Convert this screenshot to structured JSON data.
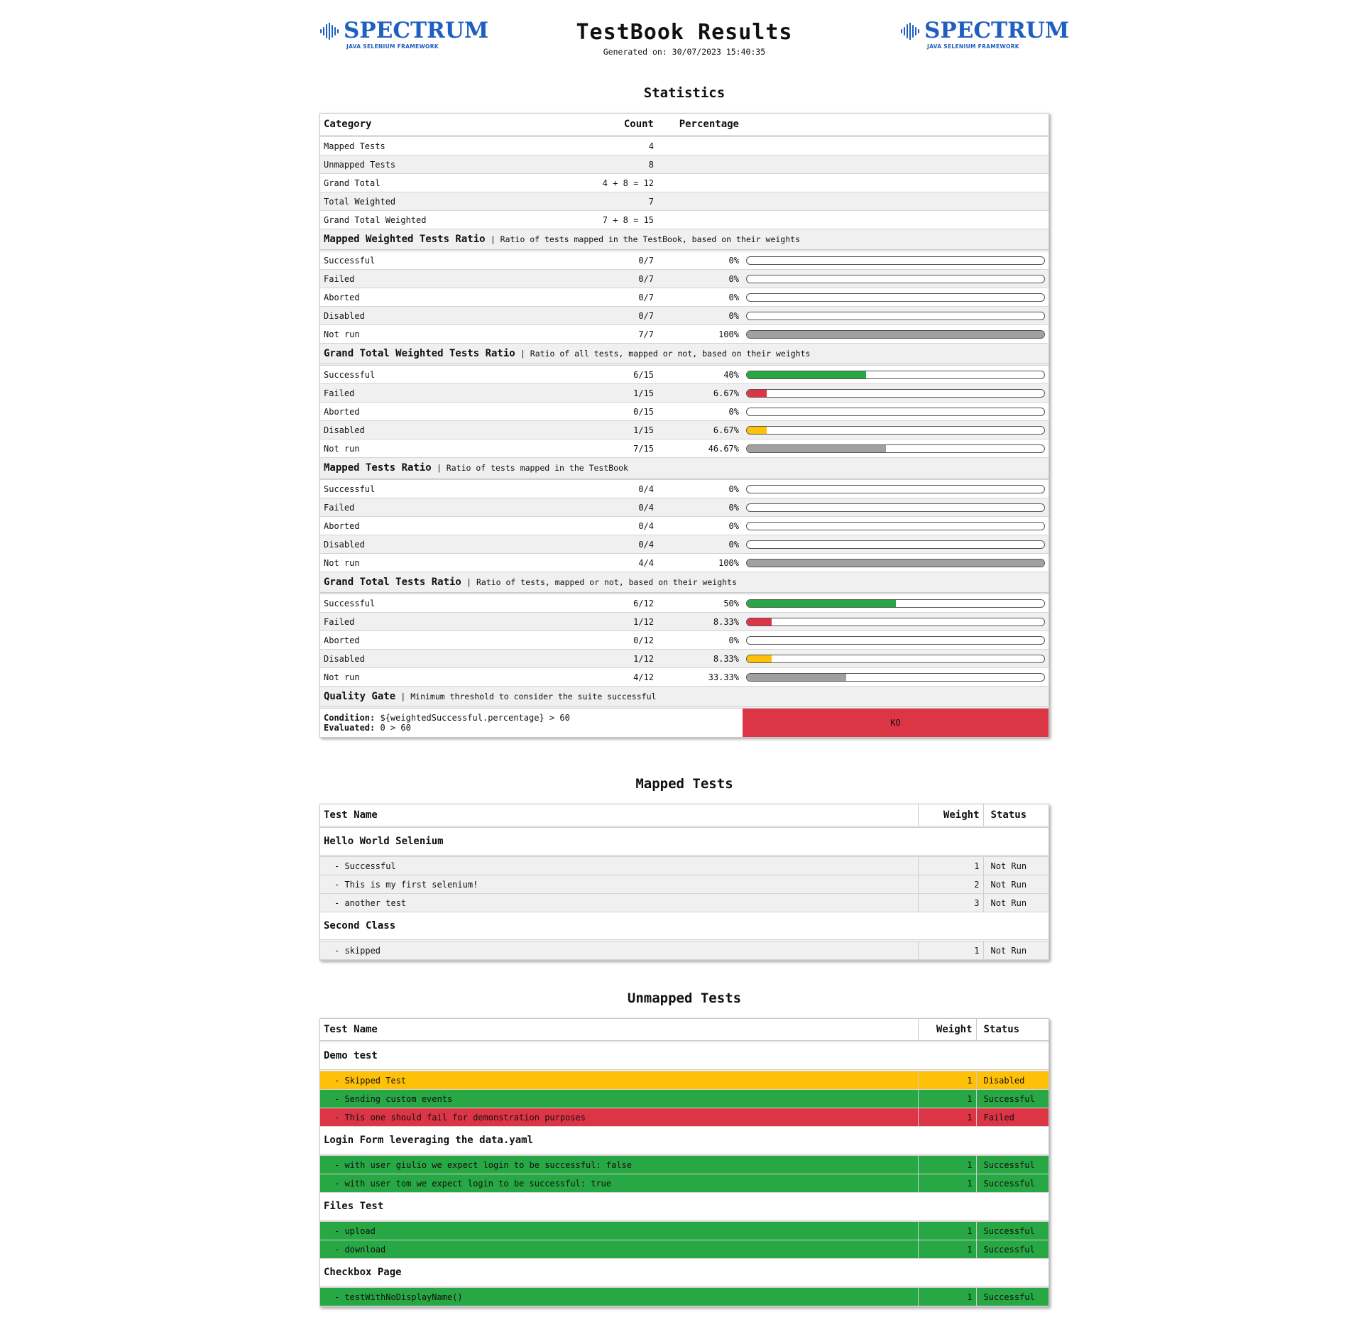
{
  "header": {
    "logo_word": "SPECTRUM",
    "logo_sub": "JAVA SELENIUM FRAMEWORK",
    "title": "TestBook Results",
    "generated": "Generated on: 30/07/2023 15:40:35"
  },
  "colors": {
    "successful": "#28a745",
    "failed": "#dc3545",
    "aborted": "#6c757d",
    "disabled": "#ffc107",
    "not_run": "#a0a0a0",
    "brand": "#1f5fbf"
  },
  "statistics": {
    "heading": "Statistics",
    "columns": {
      "category": "Category",
      "count": "Count",
      "percentage": "Percentage"
    },
    "totals": [
      {
        "label": "Mapped Tests",
        "count": "4"
      },
      {
        "label": "Unmapped Tests",
        "count": "8"
      },
      {
        "label": "Grand Total",
        "count": "4 + 8 = 12"
      },
      {
        "label": "Total Weighted",
        "count": "7"
      },
      {
        "label": "Grand Total Weighted",
        "count": "7 + 8 = 15"
      }
    ],
    "sections": [
      {
        "title": "Mapped Weighted Tests Ratio",
        "desc": "| Ratio of tests mapped in the TestBook, based on their weights",
        "rows": [
          {
            "label": "Successful",
            "count": "0/7",
            "pct": "0%",
            "value": 0,
            "kind": "successful"
          },
          {
            "label": "Failed",
            "count": "0/7",
            "pct": "0%",
            "value": 0,
            "kind": "failed"
          },
          {
            "label": "Aborted",
            "count": "0/7",
            "pct": "0%",
            "value": 0,
            "kind": "aborted"
          },
          {
            "label": "Disabled",
            "count": "0/7",
            "pct": "0%",
            "value": 0,
            "kind": "disabled"
          },
          {
            "label": "Not run",
            "count": "7/7",
            "pct": "100%",
            "value": 100,
            "kind": "not_run"
          }
        ]
      },
      {
        "title": "Grand Total Weighted Tests Ratio",
        "desc": "| Ratio of all tests, mapped or not, based on their weights",
        "rows": [
          {
            "label": "Successful",
            "count": "6/15",
            "pct": "40%",
            "value": 40,
            "kind": "successful"
          },
          {
            "label": "Failed",
            "count": "1/15",
            "pct": "6.67%",
            "value": 6.67,
            "kind": "failed"
          },
          {
            "label": "Aborted",
            "count": "0/15",
            "pct": "0%",
            "value": 0,
            "kind": "aborted"
          },
          {
            "label": "Disabled",
            "count": "1/15",
            "pct": "6.67%",
            "value": 6.67,
            "kind": "disabled"
          },
          {
            "label": "Not run",
            "count": "7/15",
            "pct": "46.67%",
            "value": 46.67,
            "kind": "not_run"
          }
        ]
      },
      {
        "title": "Mapped Tests Ratio",
        "desc": "| Ratio of tests mapped in the TestBook",
        "rows": [
          {
            "label": "Successful",
            "count": "0/4",
            "pct": "0%",
            "value": 0,
            "kind": "successful"
          },
          {
            "label": "Failed",
            "count": "0/4",
            "pct": "0%",
            "value": 0,
            "kind": "failed"
          },
          {
            "label": "Aborted",
            "count": "0/4",
            "pct": "0%",
            "value": 0,
            "kind": "aborted"
          },
          {
            "label": "Disabled",
            "count": "0/4",
            "pct": "0%",
            "value": 0,
            "kind": "disabled"
          },
          {
            "label": "Not run",
            "count": "4/4",
            "pct": "100%",
            "value": 100,
            "kind": "not_run"
          }
        ]
      },
      {
        "title": "Grand Total Tests Ratio",
        "desc": "| Ratio of tests, mapped or not, based on their weights",
        "rows": [
          {
            "label": "Successful",
            "count": "6/12",
            "pct": "50%",
            "value": 50,
            "kind": "successful"
          },
          {
            "label": "Failed",
            "count": "1/12",
            "pct": "8.33%",
            "value": 8.33,
            "kind": "failed"
          },
          {
            "label": "Aborted",
            "count": "0/12",
            "pct": "0%",
            "value": 0,
            "kind": "aborted"
          },
          {
            "label": "Disabled",
            "count": "1/12",
            "pct": "8.33%",
            "value": 8.33,
            "kind": "disabled"
          },
          {
            "label": "Not run",
            "count": "4/12",
            "pct": "33.33%",
            "value": 33.33,
            "kind": "not_run"
          }
        ]
      }
    ],
    "quality_gate": {
      "title": "Quality Gate",
      "desc": "| Minimum threshold to consider the suite successful",
      "condition_label": "Condition:",
      "condition": "${weightedSuccessful.percentage} > 60",
      "evaluated_label": "Evaluated:",
      "evaluated": "0 > 60",
      "result": "KO"
    }
  },
  "mapped": {
    "heading": "Mapped Tests",
    "columns": {
      "name": "Test Name",
      "weight": "Weight",
      "status": "Status"
    },
    "classes": [
      {
        "name": "Hello World Selenium",
        "tests": [
          {
            "name": "- Successful",
            "weight": "1",
            "status": "Not Run"
          },
          {
            "name": "- This is my first selenium!",
            "weight": "2",
            "status": "Not Run"
          },
          {
            "name": "- another test",
            "weight": "3",
            "status": "Not Run"
          }
        ]
      },
      {
        "name": "Second Class",
        "tests": [
          {
            "name": "- skipped",
            "weight": "1",
            "status": "Not Run"
          }
        ]
      }
    ]
  },
  "unmapped": {
    "heading": "Unmapped Tests",
    "columns": {
      "name": "Test Name",
      "weight": "Weight",
      "status": "Status"
    },
    "classes": [
      {
        "name": "Demo test",
        "tests": [
          {
            "name": "- Skipped Test",
            "weight": "1",
            "status": "Disabled"
          },
          {
            "name": "- Sending custom events",
            "weight": "1",
            "status": "Successful"
          },
          {
            "name": "- This one should fail for demonstration purposes",
            "weight": "1",
            "status": "Failed"
          }
        ]
      },
      {
        "name": "Login Form leveraging the data.yaml",
        "tests": [
          {
            "name": "- with user giulio we expect login to be successful: false",
            "weight": "1",
            "status": "Successful"
          },
          {
            "name": "- with user tom we expect login to be successful: true",
            "weight": "1",
            "status": "Successful"
          }
        ]
      },
      {
        "name": "Files Test",
        "tests": [
          {
            "name": "- upload",
            "weight": "1",
            "status": "Successful"
          },
          {
            "name": "- download",
            "weight": "1",
            "status": "Successful"
          }
        ]
      },
      {
        "name": "Checkbox Page",
        "tests": [
          {
            "name": "- testWithNoDisplayName()",
            "weight": "1",
            "status": "Successful"
          }
        ]
      }
    ]
  }
}
